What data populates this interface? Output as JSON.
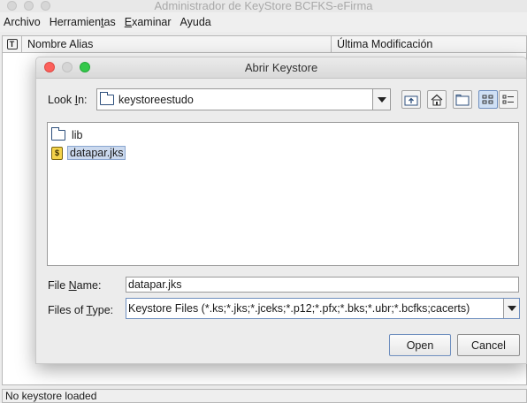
{
  "window": {
    "title": "Administrador de KeyStore BCFKS-eFirma"
  },
  "menubar": {
    "items": [
      "Archivo",
      "Herramien",
      "t",
      "as",
      "E",
      "xaminar",
      "Ayuda"
    ]
  },
  "table": {
    "icon_col": "T",
    "alias_col": "Nombre Alias",
    "date_col": "Última Modificación"
  },
  "status": {
    "text": "No keystore loaded"
  },
  "dialog": {
    "title": "Abrir Keystore",
    "look_in_label_pre": "Look ",
    "look_in_label_u": "I",
    "look_in_label_post": "n:",
    "look_in_value": "keystoreestudo",
    "files": [
      {
        "name": "lib",
        "icon": "folder-icon",
        "selected": false
      },
      {
        "name": "datapar.jks",
        "icon": "keystore-file-icon",
        "selected": true
      }
    ],
    "file_name_label_pre": "File ",
    "file_name_label_u": "N",
    "file_name_label_post": "ame:",
    "file_name_value": "datapar.jks",
    "file_type_label_pre": "Files of ",
    "file_type_label_u": "T",
    "file_type_label_post": "ype:",
    "file_type_value": "Keystore Files (*.ks;*.jks;*.jceks;*.p12;*.pfx;*.bks;*.ubr;*.bcfks;cacerts)",
    "open_label": "Open",
    "cancel_label": "Cancel",
    "toolbar_icons": [
      "up-folder-icon",
      "home-icon",
      "new-folder-icon",
      "list-view-icon",
      "details-view-icon"
    ]
  }
}
